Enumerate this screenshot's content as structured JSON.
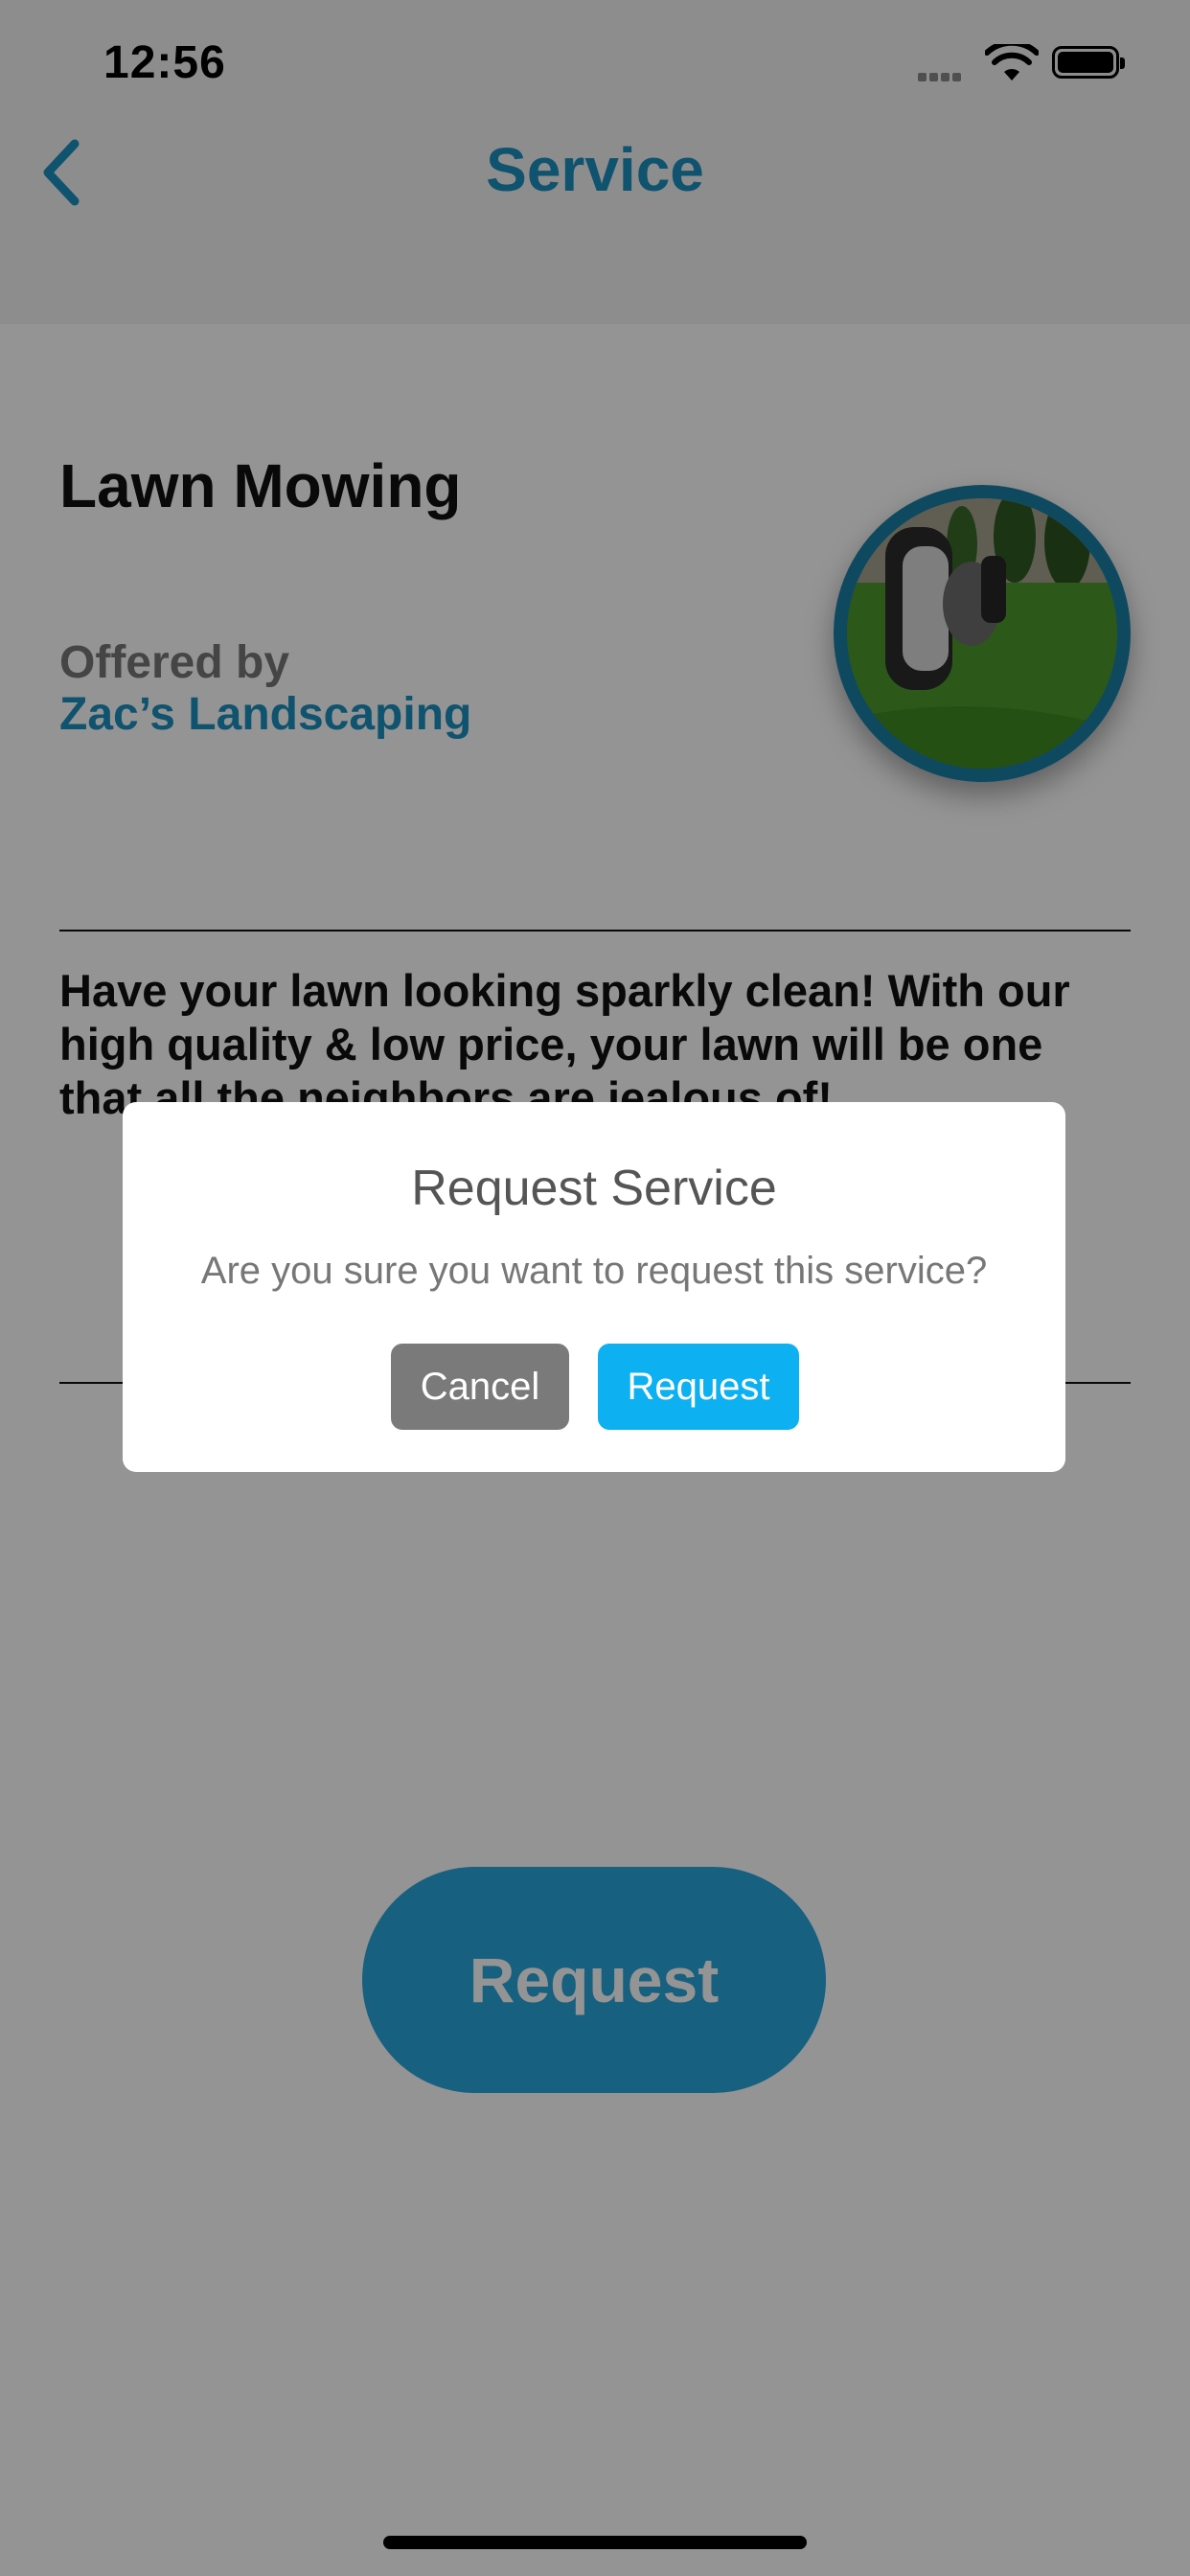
{
  "status_bar": {
    "time": "12:56"
  },
  "nav": {
    "title": "Service",
    "back_icon": "chevron-left-icon"
  },
  "service": {
    "title": "Lawn Mowing",
    "offered_label": "Offered by",
    "provider": "Zac’s Landscaping",
    "image": "lawn-mower-on-grass",
    "description": "Have your lawn looking sparkly clean! With our high quality & low price, your lawn will be one that all the neighbors are jealous of!"
  },
  "primary_button": "Request",
  "dialog": {
    "title": "Request Service",
    "message": "Are you sure you want to request this service?",
    "cancel_label": "Cancel",
    "request_label": "Request"
  },
  "colors": {
    "accent": "#1d8fbf",
    "button": "#2aa6dd",
    "dialog_request": "#0db0f0",
    "dialog_cancel": "#7a7a7a"
  }
}
